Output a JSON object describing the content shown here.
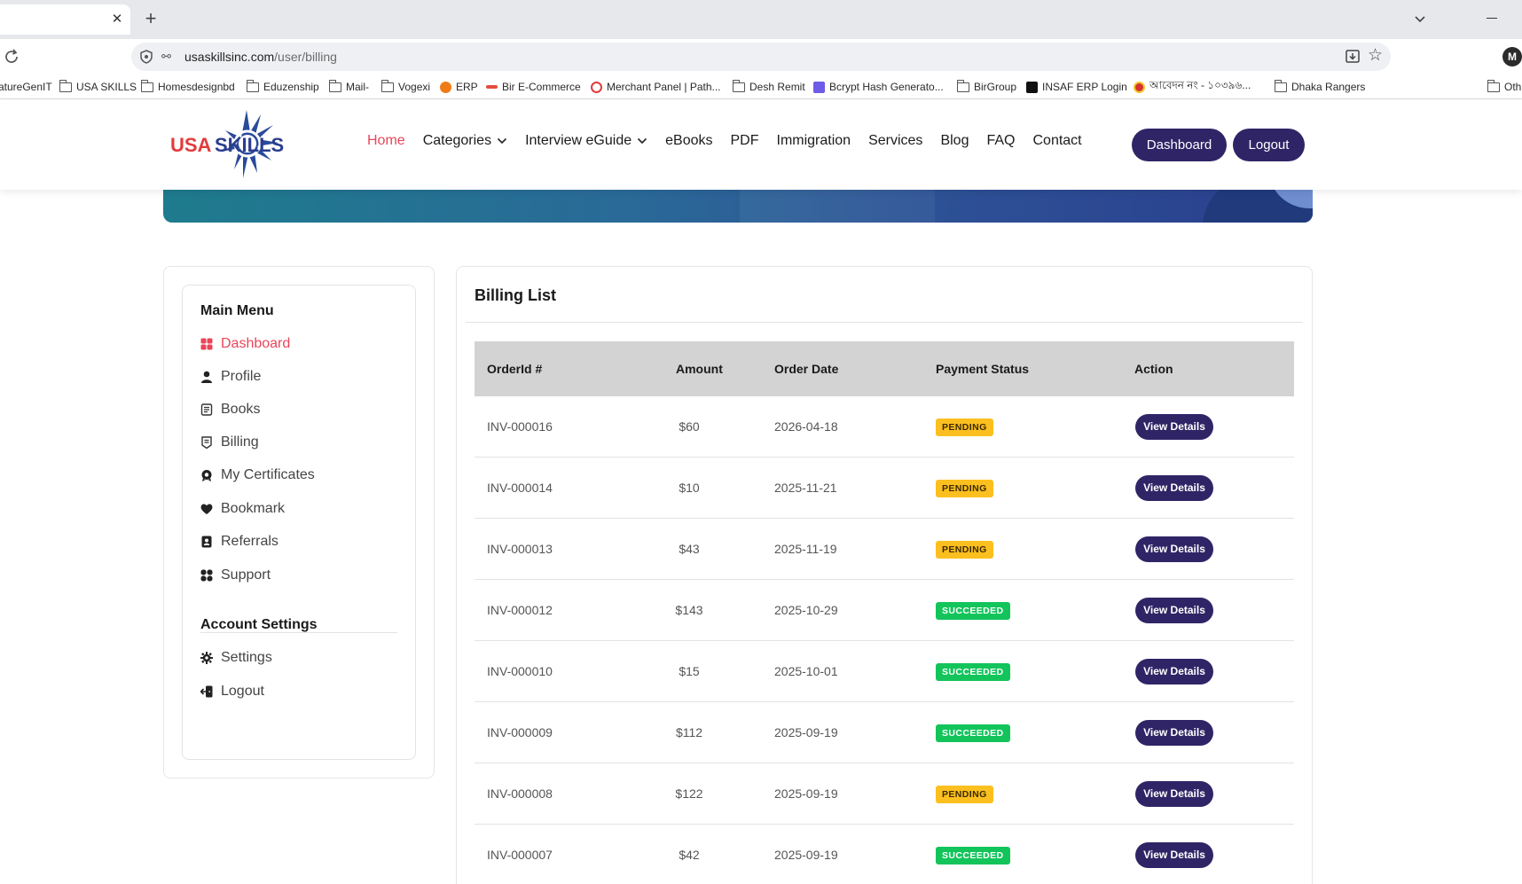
{
  "browser": {
    "url_host": "usaskillsinc.com",
    "url_path": "/user/billing",
    "profile_initial": "M",
    "bookmarks": [
      {
        "label": "atureGenIT",
        "type": "folder"
      },
      {
        "label": "USA SKILLS",
        "type": "folder"
      },
      {
        "label": "Homesdesignbd",
        "type": "folder"
      },
      {
        "label": "Eduzenship",
        "type": "folder"
      },
      {
        "label": "Mail-",
        "type": "folder"
      },
      {
        "label": "Vogexi",
        "type": "folder"
      },
      {
        "label": "ERP",
        "type": "site"
      },
      {
        "label": "Bir E-Commerce",
        "type": "site"
      },
      {
        "label": "Merchant Panel | Path...",
        "type": "site"
      },
      {
        "label": "Desh Remit",
        "type": "folder"
      },
      {
        "label": "Bcrypt Hash Generato...",
        "type": "site"
      },
      {
        "label": "BirGroup",
        "type": "folder"
      },
      {
        "label": "INSAF ERP Login",
        "type": "site"
      },
      {
        "label": "আবেদন নং - ১০৩৯৬...",
        "type": "site"
      },
      {
        "label": "Dhaka Rangers",
        "type": "folder"
      },
      {
        "label": "Oth",
        "type": "folder"
      }
    ]
  },
  "header": {
    "logo_text": {
      "usa": "USA",
      "skills": "SKILLS"
    },
    "nav": [
      "Home",
      "Categories",
      "Interview eGuide",
      "eBooks",
      "PDF",
      "Immigration",
      "Services",
      "Blog",
      "FAQ",
      "Contact"
    ],
    "dashboard_label": "Dashboard",
    "logout_label": "Logout"
  },
  "sidebar": {
    "main_menu_title": "Main Menu",
    "items": [
      {
        "label": "Dashboard",
        "icon": "dashboard-icon"
      },
      {
        "label": "Profile",
        "icon": "user-icon"
      },
      {
        "label": "Books",
        "icon": "book-icon"
      },
      {
        "label": "Billing",
        "icon": "receipt-icon"
      },
      {
        "label": "My Certificates",
        "icon": "certificate-icon"
      },
      {
        "label": "Bookmark",
        "icon": "heart-icon"
      },
      {
        "label": "Referrals",
        "icon": "referral-icon"
      },
      {
        "label": "Support",
        "icon": "support-icon"
      }
    ],
    "account_title": "Account Settings",
    "account_items": [
      {
        "label": "Settings",
        "icon": "gear-icon"
      },
      {
        "label": "Logout",
        "icon": "logout-icon"
      }
    ]
  },
  "billing": {
    "title": "Billing List",
    "columns": [
      "OrderId #",
      "Amount",
      "Order Date",
      "Payment Status",
      "Action"
    ],
    "rows": [
      {
        "order_id": "INV-000016",
        "amount": "$60",
        "date": "2026-04-18",
        "status": "PENDING",
        "action": "View Details"
      },
      {
        "order_id": "INV-000014",
        "amount": "$10",
        "date": "2025-11-21",
        "status": "PENDING",
        "action": "View Details"
      },
      {
        "order_id": "INV-000013",
        "amount": "$43",
        "date": "2025-11-19",
        "status": "PENDING",
        "action": "View Details"
      },
      {
        "order_id": "INV-000012",
        "amount": "$143",
        "date": "2025-10-29",
        "status": "SUCCEEDED",
        "action": "View Details"
      },
      {
        "order_id": "INV-000010",
        "amount": "$15",
        "date": "2025-10-01",
        "status": "SUCCEEDED",
        "action": "View Details"
      },
      {
        "order_id": "INV-000009",
        "amount": "$112",
        "date": "2025-09-19",
        "status": "SUCCEEDED",
        "action": "View Details"
      },
      {
        "order_id": "INV-000008",
        "amount": "$122",
        "date": "2025-09-19",
        "status": "PENDING",
        "action": "View Details"
      },
      {
        "order_id": "INV-000007",
        "amount": "$42",
        "date": "2025-09-19",
        "status": "SUCCEEDED",
        "action": "View Details"
      }
    ]
  },
  "colors": {
    "brand_dark": "#2f2566",
    "accent_red": "#e8465a",
    "pending": "#fbbf1f",
    "succeeded": "#13c45b"
  }
}
